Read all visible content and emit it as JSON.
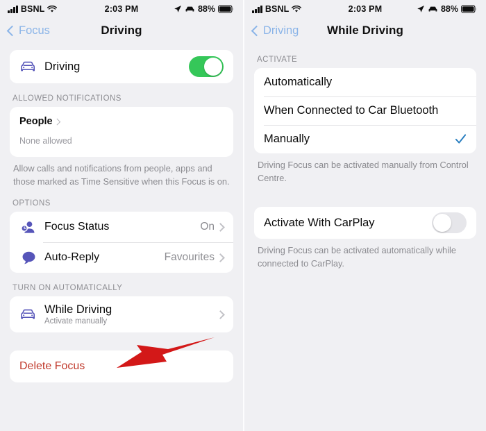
{
  "colors": {
    "accent_green": "#35c759",
    "accent_blue": "#8ab4e8",
    "check_blue": "#2a7fc0",
    "icon_purple": "#5655b9",
    "destructive_red": "#c0392b",
    "arrow_red": "#d31818",
    "background": "#f0f0f3"
  },
  "left": {
    "status_bar": {
      "carrier": "BSNL",
      "time": "2:03 PM",
      "battery_percent": "88%",
      "icons": [
        "signal-bars-icon",
        "wifi-icon",
        "location-arrow-icon",
        "car-icon",
        "battery-icon"
      ]
    },
    "nav": {
      "back_label": "Focus",
      "title": "Driving"
    },
    "driving_row": {
      "label": "Driving",
      "icon": "car-icon",
      "toggle_state": "on"
    },
    "allowed_notifications": {
      "header": "ALLOWED NOTIFICATIONS",
      "people_title": "People",
      "people_value": "None allowed",
      "footnote": "Allow calls and notifications from people, apps and those marked as Time Sensitive when this Focus is on."
    },
    "options": {
      "header": "OPTIONS",
      "rows": [
        {
          "label": "Focus Status",
          "value": "On",
          "icon": "focus-status-icon"
        },
        {
          "label": "Auto-Reply",
          "value": "Favourites",
          "icon": "speech-bubble-icon"
        }
      ]
    },
    "turn_on_automatically": {
      "header": "TURN ON AUTOMATICALLY",
      "row": {
        "label": "While Driving",
        "sublabel": "Activate manually",
        "icon": "car-icon"
      }
    },
    "delete": {
      "label": "Delete Focus"
    }
  },
  "right": {
    "status_bar": {
      "carrier": "BSNL",
      "time": "2:03 PM",
      "battery_percent": "88%",
      "icons": [
        "signal-bars-icon",
        "wifi-icon",
        "location-arrow-icon",
        "car-icon",
        "battery-icon"
      ]
    },
    "nav": {
      "back_label": "Driving",
      "title": "While Driving"
    },
    "activate": {
      "header": "ACTIVATE",
      "options": [
        {
          "label": "Automatically",
          "selected": false
        },
        {
          "label": "When Connected to Car Bluetooth",
          "selected": false
        },
        {
          "label": "Manually",
          "selected": true
        }
      ],
      "footnote": "Driving Focus can be activated manually from Control Centre."
    },
    "carplay": {
      "label": "Activate With CarPlay",
      "toggle_state": "off",
      "footnote": "Driving Focus can be activated automatically while connected to CarPlay."
    }
  },
  "annotation": {
    "arrow": "red-arrow-pointing-to-while-driving"
  }
}
